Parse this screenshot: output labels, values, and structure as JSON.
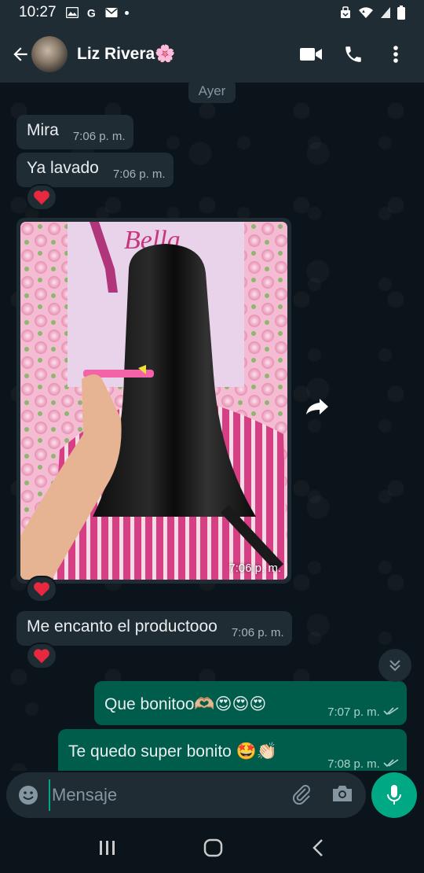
{
  "status_bar": {
    "time": "10:27",
    "left_icons": [
      "image-icon",
      "google-icon",
      "mail-icon",
      "dot-icon"
    ],
    "right_icons": [
      "alarm-icon",
      "wifi-icon",
      "signal-icon",
      "battery-icon"
    ]
  },
  "header": {
    "contact_name": "Liz Rivera🌸",
    "actions": [
      "video-call-icon",
      "phone-call-icon",
      "more-vert-icon"
    ]
  },
  "chat": {
    "date_label": "Ayer",
    "messages": [
      {
        "direction": "in",
        "text": "Mira",
        "time": "7:06 p. m."
      },
      {
        "direction": "in",
        "text": "Ya lavado",
        "time": "7:06 p. m.",
        "reaction": "❤️"
      },
      {
        "direction": "in",
        "type": "image",
        "image_text": "Bella",
        "time": "7:06 p. m.",
        "reaction": "❤️"
      },
      {
        "direction": "in",
        "text": "Me encanto el productooo",
        "time": "7:06 p. m.",
        "reaction": "❤️"
      },
      {
        "direction": "out",
        "text": "Que bonitoo🫶🏼😍😍😍",
        "time": "7:07 p. m.",
        "status": "read"
      },
      {
        "direction": "out",
        "text": "Te quedo  super bonito 🤩👏🏻",
        "time": "7:08 p. m.",
        "status": "read"
      }
    ]
  },
  "composer": {
    "placeholder": "Mensaje",
    "value": ""
  },
  "colors": {
    "background": "#0b141a",
    "bar": "#1f2c34",
    "incoming_bubble": "#1f2c34",
    "outgoing_bubble": "#005c4b",
    "accent": "#00a884",
    "heart": "#e8283f"
  }
}
